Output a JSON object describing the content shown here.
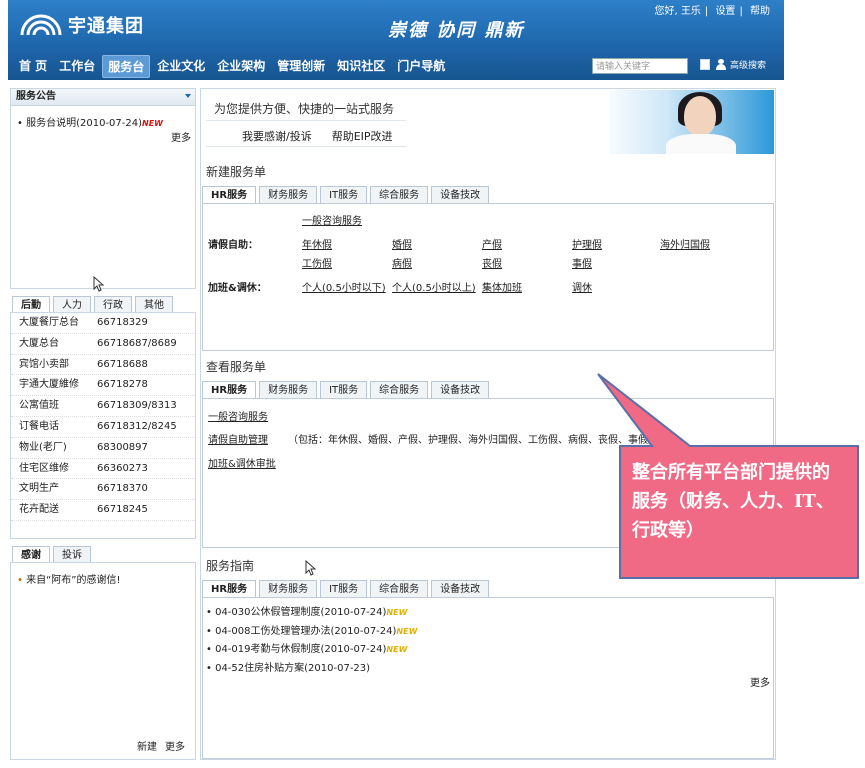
{
  "header": {
    "logo_text": "宇通集团",
    "slogan": "崇德  协同  鼎新",
    "user_greeting": "您好, 王乐",
    "settings": "设置",
    "help": "帮助",
    "nav": [
      "首 页",
      "工作台",
      "服务台",
      "企业文化",
      "企业架构",
      "管理创新",
      "知识社区",
      "门户导航"
    ],
    "active_nav": 2,
    "search_placeholder": "请输入关键字",
    "search_label": "高级搜索"
  },
  "announcement": {
    "title": "服务公告",
    "items": [
      {
        "text": "服务台说明(2010-07-24)",
        "badge": "NEW"
      }
    ],
    "more": "更多"
  },
  "contacts": {
    "tabs": [
      "后勤",
      "人力",
      "行政",
      "其他"
    ],
    "rows": [
      {
        "name": "大厦餐厅总台",
        "phone": "66718329"
      },
      {
        "name": "大厦总台",
        "phone": "66718687/8689"
      },
      {
        "name": "宾馆小卖部",
        "phone": "66718688"
      },
      {
        "name": "宇通大厦維修",
        "phone": "66718278"
      },
      {
        "name": "公寓值班",
        "phone": "66718309/8313"
      },
      {
        "name": "订餐电话",
        "phone": "66718312/8245"
      },
      {
        "name": "物业(老厂)",
        "phone": "68300897"
      },
      {
        "name": "住宅区维修",
        "phone": "66360273"
      },
      {
        "name": "文明生产",
        "phone": "66718370"
      },
      {
        "name": "花卉配送",
        "phone": "66718245"
      }
    ]
  },
  "thanks": {
    "tabs": [
      "感谢",
      "投诉"
    ],
    "items": [
      "来自“阿布”的感谢信!"
    ],
    "new_label": "新建",
    "more": "更多"
  },
  "intro": {
    "text": "为您提供方便、快捷的一站式服务",
    "link1": "我要感谢/投诉",
    "link2": "帮助EIP改进"
  },
  "service_tabs": [
    "HR服务",
    "财务服务",
    "IT服务",
    "综合服务",
    "设备技改"
  ],
  "new_order": {
    "title": "新建服务单",
    "general": "一般咨询服务",
    "leave_label": "请假自助：",
    "leave_row1": [
      "年休假",
      "婚假",
      "产假",
      "护理假",
      "海外归国假"
    ],
    "leave_row2": [
      "工伤假",
      "病假",
      "丧假",
      "事假"
    ],
    "ot_label": "加班&调休：",
    "ot_items": [
      "个人(0.5小时以下)",
      "个人(0.5小时以上)",
      "集体加班",
      "调休"
    ]
  },
  "view_order": {
    "title": "查看服务单",
    "general": "一般咨询服务",
    "leave_mgmt": "请假自助管理",
    "leave_note": "（包括：年休假、婚假、产假、护理假、海外归国假、工伤假、病假、丧假、事假）",
    "ot_review": "加班&调休审批"
  },
  "guide": {
    "title": "服务指南",
    "items": [
      {
        "text": "04-030公休假管理制度(2010-07-24)",
        "badge": "NEW"
      },
      {
        "text": "04-008工伤处理管理办法(2010-07-24)",
        "badge": "NEW"
      },
      {
        "text": "04-019考勤与休假制度(2010-07-24)",
        "badge": "NEW"
      },
      {
        "text": "04-52住房补贴方案(2010-07-23)",
        "badge": ""
      }
    ],
    "more": "更多"
  },
  "callout": {
    "text": "整合所有平台部门提供的服务（财务、人力、IT、行政等）",
    "fill": "#f06a86",
    "stroke": "#5a6fa8"
  },
  "colors": {
    "header_blue": "#1f67ad",
    "new_red": "#e01010",
    "new_yellow": "#e0b000"
  }
}
